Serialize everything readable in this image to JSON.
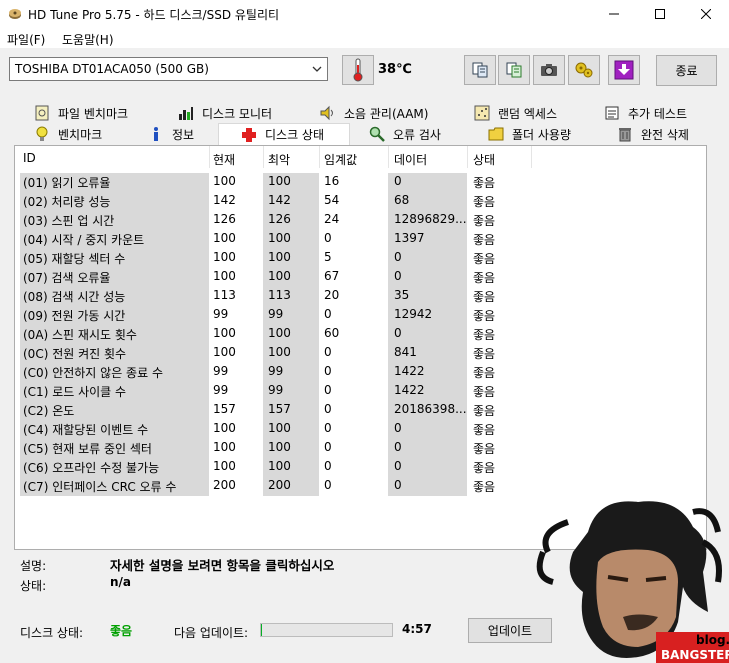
{
  "window": {
    "title": "HD Tune Pro 5.75 - 하드 디스크/SSD 유틸리티"
  },
  "menu": {
    "file": "파일(F)",
    "help": "도움말(H)"
  },
  "toolbar": {
    "drive": "TOSHIBA DT01ACA050 (500 GB)",
    "temperature": "38℃",
    "exit_label": "종료"
  },
  "tabs_row1": [
    {
      "label": "파일 벤치마크",
      "icon": "file-benchmark-icon"
    },
    {
      "label": "디스크 모니터",
      "icon": "bar-chart-icon"
    },
    {
      "label": "소음 관리(AAM)",
      "icon": "speaker-icon"
    },
    {
      "label": "랜덤 엑세스",
      "icon": "random-access-icon"
    },
    {
      "label": "추가 테스트",
      "icon": "extra-tests-icon"
    }
  ],
  "tabs_row2": [
    {
      "label": "벤치마크",
      "icon": "lightbulb-icon"
    },
    {
      "label": "정보",
      "icon": "info-icon"
    },
    {
      "label": "디스크 상태",
      "icon": "red-cross-icon",
      "active": true
    },
    {
      "label": "오류 검사",
      "icon": "magnifier-icon"
    },
    {
      "label": "폴더 사용량",
      "icon": "folder-icon"
    },
    {
      "label": "완전 삭제",
      "icon": "trash-icon"
    }
  ],
  "table": {
    "headers": [
      "ID",
      "현재",
      "최악",
      "임계값",
      "데이터",
      "상태"
    ],
    "rows": [
      [
        "(01) 읽기 오류율",
        "100",
        "100",
        "16",
        "0",
        "좋음"
      ],
      [
        "(02) 처리량 성능",
        "142",
        "142",
        "54",
        "68",
        "좋음"
      ],
      [
        "(03) 스핀 업 시간",
        "126",
        "126",
        "24",
        "12896829...",
        "좋음"
      ],
      [
        "(04) 시작 / 중지 카운트",
        "100",
        "100",
        "0",
        "1397",
        "좋음"
      ],
      [
        "(05) 재할당 섹터 수",
        "100",
        "100",
        "5",
        "0",
        "좋음"
      ],
      [
        "(07) 검색 오류율",
        "100",
        "100",
        "67",
        "0",
        "좋음"
      ],
      [
        "(08) 검색 시간 성능",
        "113",
        "113",
        "20",
        "35",
        "좋음"
      ],
      [
        "(09) 전원 가동 시간",
        "99",
        "99",
        "0",
        "12942",
        "좋음"
      ],
      [
        "(0A) 스핀 재시도 횟수",
        "100",
        "100",
        "60",
        "0",
        "좋음"
      ],
      [
        "(0C) 전원 켜진 횟수",
        "100",
        "100",
        "0",
        "841",
        "좋음"
      ],
      [
        "(C0) 안전하지 않은 종료 수",
        "99",
        "99",
        "0",
        "1422",
        "좋음"
      ],
      [
        "(C1) 로드 사이클 수",
        "99",
        "99",
        "0",
        "1422",
        "좋음"
      ],
      [
        "(C2) 온도",
        "157",
        "157",
        "0",
        "20186398...",
        "좋음"
      ],
      [
        "(C4) 재할당된 이벤트 수",
        "100",
        "100",
        "0",
        "0",
        "좋음"
      ],
      [
        "(C5) 현재 보류 중인 섹터",
        "100",
        "100",
        "0",
        "0",
        "좋음"
      ],
      [
        "(C6) 오프라인 수정 불가능",
        "100",
        "100",
        "0",
        "0",
        "좋음"
      ],
      [
        "(C7) 인터페이스 CRC 오류 수",
        "200",
        "200",
        "0",
        "0",
        "좋음"
      ]
    ]
  },
  "details": {
    "desc_label": "설명:",
    "desc_value": "자세한 설명을 보려면 항목을 클릭하십시오",
    "state_label": "상태:",
    "state_value": "n/a"
  },
  "status": {
    "disk_label": "디스크 상태:",
    "disk_value": "좋음",
    "next_label": "다음 업데이트:",
    "progress": 0.01,
    "countdown": "4:57",
    "update_label": "업데이트"
  },
  "watermark": {
    "line1": "blog.",
    "line2": "BANGSTER"
  },
  "colors": {
    "good": "#00a000",
    "progress": "#06b025"
  }
}
